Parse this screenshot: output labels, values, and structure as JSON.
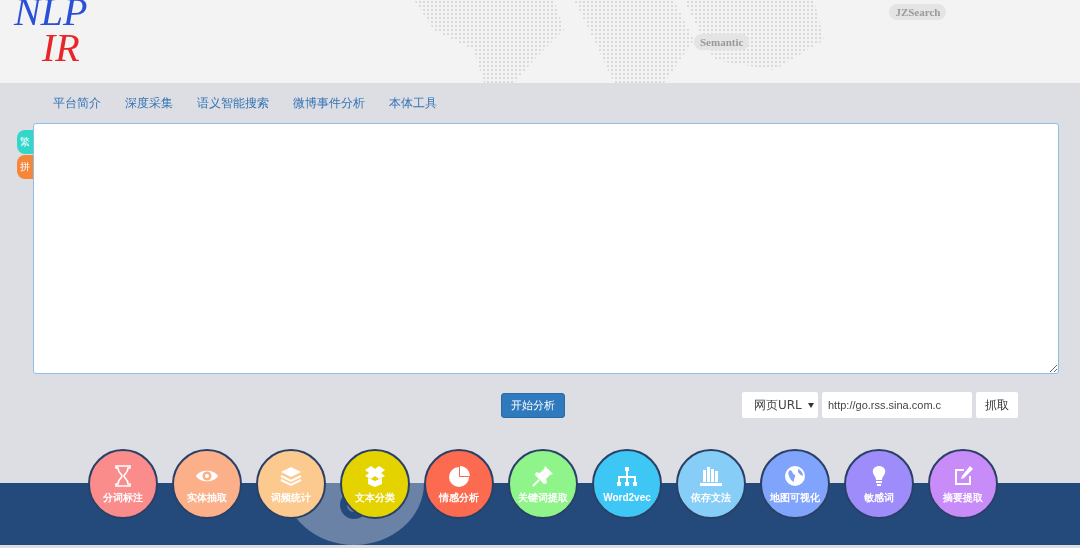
{
  "header": {
    "logo_top": "NLP",
    "logo_bottom": "IR",
    "tags": [
      "Semantic",
      "JZSearch"
    ]
  },
  "nav": [
    "平台简介",
    "深度采集",
    "语义智能搜索",
    "微博事件分析",
    "本体工具"
  ],
  "side_tabs": [
    {
      "label": "繁",
      "color": "#33d6c8"
    },
    {
      "label": "拼",
      "color": "#f5873a"
    }
  ],
  "controls": {
    "analyze_button": "开始分析",
    "source_select": "网页URL",
    "url_field": "http://go.rss.sina.com.c",
    "fetch_button": "抓取"
  },
  "tools": [
    {
      "label": "分词标注",
      "color": "#fb8c8c"
    },
    {
      "label": "实体抽取",
      "color": "#fbb08a"
    },
    {
      "label": "词频统计",
      "color": "#fcc98f"
    },
    {
      "label": "文本分类",
      "color": "#e5d300"
    },
    {
      "label": "情感分析",
      "color": "#fc6a4f"
    },
    {
      "label": "关键词提取",
      "color": "#8ff58a"
    },
    {
      "label": "Word2vec",
      "color": "#3ec6f5"
    },
    {
      "label": "依存文法",
      "color": "#86cef8"
    },
    {
      "label": "地图可视化",
      "color": "#80a4fb"
    },
    {
      "label": "敏感词",
      "color": "#9d8cf9"
    },
    {
      "label": "摘要提取",
      "color": "#c88cf8"
    }
  ]
}
